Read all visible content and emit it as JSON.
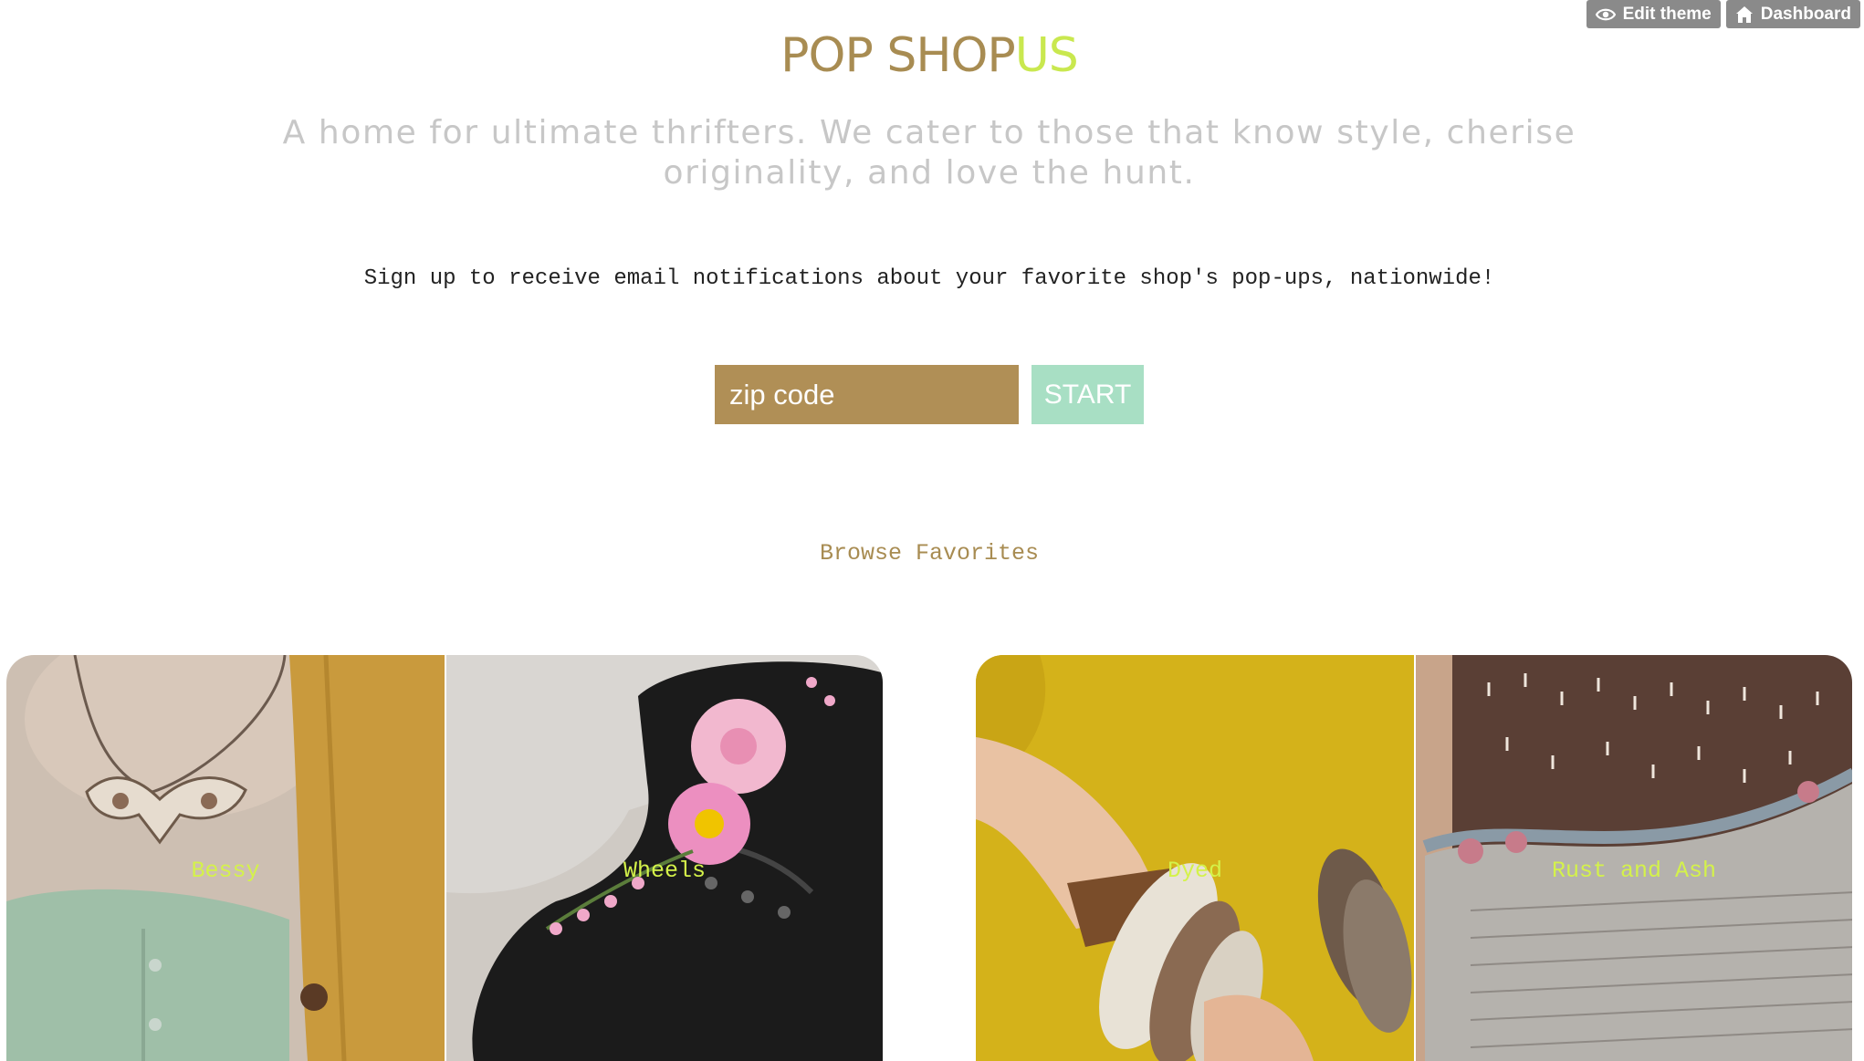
{
  "admin_bar": {
    "edit_theme_label": "Edit theme",
    "edit_theme_icon": "eye-icon",
    "dashboard_label": "Dashboard",
    "dashboard_icon": "home-icon"
  },
  "logo": {
    "main": "POP SHOP",
    "accent": "US"
  },
  "tagline": "A home for ultimate thrifters. We cater to those that know style, cherise originality, and love the hunt.",
  "signup": {
    "text": "Sign up to receive email notifications about your favorite shop's pop-ups, nationwide!",
    "zip_placeholder": "zip code",
    "start_label": "START"
  },
  "browse": {
    "title": "Browse Favorites",
    "items": [
      {
        "label": "Bessy"
      },
      {
        "label": "Wheels"
      },
      {
        "label": "Dyed"
      },
      {
        "label": "Rust and Ash"
      }
    ]
  },
  "colors": {
    "brand": "#a88c52",
    "accent": "#c9e84f",
    "zip_field": "#b08f56",
    "start_button": "#a8dfc4",
    "tile_label": "#d4f24a"
  }
}
